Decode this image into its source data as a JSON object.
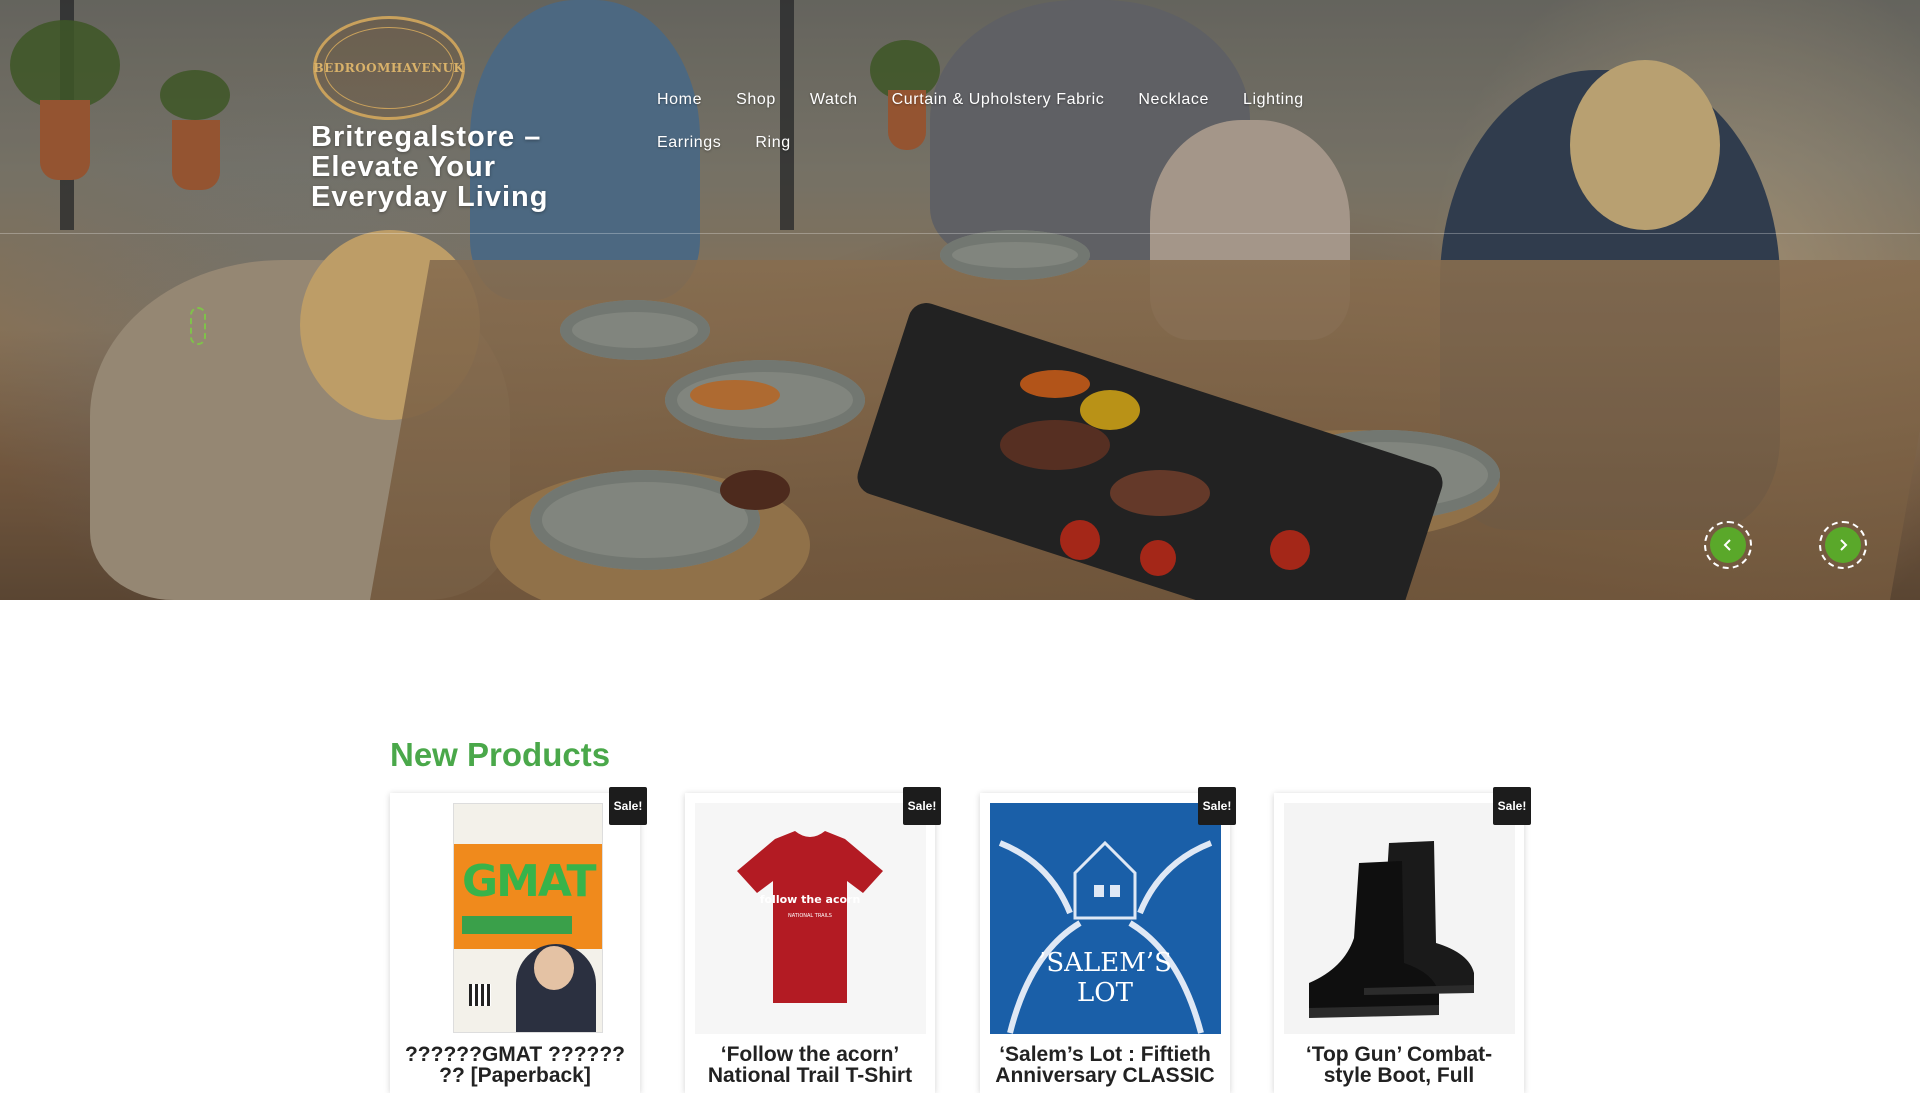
{
  "header": {
    "logo_text": "BEDROOMHAVENUK",
    "site_title": "Britregalstore – Elevate Your Everyday Living",
    "nav_row1": [
      "Home",
      "Shop",
      "Watch",
      "Curtain & Upholstery Fabric",
      "Necklace",
      "Lighting"
    ],
    "nav_row2": [
      "Earrings",
      "Ring"
    ]
  },
  "slider": {
    "prev_icon": "chevron-left-icon",
    "next_icon": "chevron-right-icon"
  },
  "products_section": {
    "title": "New Products",
    "items": [
      {
        "badge": "Sale!",
        "name_line1": "??????GMAT ??????",
        "name_line2": "?? [Paperback]"
      },
      {
        "badge": "Sale!",
        "name_line1": "‘Follow the acorn’",
        "name_line2": "National Trail T-Shirt"
      },
      {
        "badge": "Sale!",
        "name_line1": "‘Salem’s Lot : Fiftieth",
        "name_line2": "Anniversary CLASSIC"
      },
      {
        "badge": "Sale!",
        "name_line1": "‘Top Gun’ Combat-",
        "name_line2": "style Boot, Full"
      }
    ],
    "tshirt_text": "follow the acorn",
    "tshirt_subtext": "NATIONAL TRAILS",
    "book_text": "GMAT",
    "salem_text1": "’SALEM’S",
    "salem_text2": "LOT"
  },
  "colors": {
    "accent_green": "#4aa84a",
    "button_green": "#5aa82a",
    "badge_bg": "#1c1c1c"
  }
}
